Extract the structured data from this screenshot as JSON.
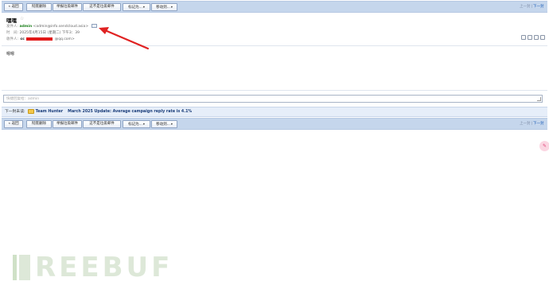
{
  "toolbar_top": {
    "back_label": "« 返回",
    "delete_label": "彻底删除",
    "report_spam_label": "举报垃圾邮件",
    "not_spam_label": "这不是垃圾邮件",
    "mark_as_label": "标记为...",
    "move_to_label": "移动到...",
    "pager": {
      "prev": "上一封",
      "sep": "|",
      "next": "下一封"
    }
  },
  "email": {
    "subject": "嘿嘿",
    "sender_label": "发件人:",
    "sender_name": "admin",
    "sender_address": "<admin@info.sendcloud.asia>",
    "time_label": "时　间:",
    "time_value": "2025年4月15日 (星期二) 下午3：39",
    "recipient_label": "收件人:",
    "recipient_prefix": "cc",
    "recipient_suffix": "@qq.com>",
    "body": "嗯嗯"
  },
  "reply": {
    "placeholder": "快捷回复给：admin"
  },
  "next_mail": {
    "label": "下一封未读:",
    "from": "Team Hunter",
    "subject": "March 2025 Update: Average campaign reply rate is 4.1%"
  },
  "toolbar_bottom": {
    "back_label": "« 返回",
    "delete_label": "彻底删除",
    "report_spam_label": "举报垃圾邮件",
    "not_spam_label": "这不是垃圾邮件",
    "mark_as_label": "标记为...",
    "move_to_label": "移动到...",
    "pager": {
      "prev": "上一封",
      "sep": "|",
      "next": "下一封"
    }
  },
  "watermark": {
    "text": "REEBUF"
  },
  "colors": {
    "toolbar_bg": "#c5d6ec",
    "sender_green": "#1a7f1a",
    "redaction_red": "#e11919",
    "annotation_arrow": "#e02222",
    "link_blue": "#1e5fb8"
  },
  "icons": {
    "contact_card": "contact-card-icon",
    "star": "star-icon",
    "folder": "folder-icon",
    "side_bubble": "chat-bubble-icon"
  }
}
